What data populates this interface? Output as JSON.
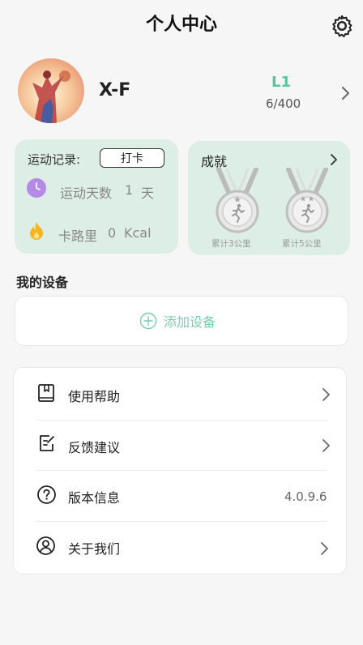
{
  "header": {
    "title": "个人中心",
    "settings_icon": "gear-icon"
  },
  "profile": {
    "username": "X-F",
    "level": "L1",
    "progress": "6/400"
  },
  "exercise": {
    "label": "运动记录:",
    "checkin_label": "打卡",
    "days_label": "运动天数",
    "days_value": "1",
    "days_unit": "天",
    "cal_label": "卡路里",
    "cal_value": "0",
    "cal_unit": "Kcal"
  },
  "achievements": {
    "title": "成就",
    "medals": [
      {
        "caption": "累计3公里",
        "stars": 1
      },
      {
        "caption": "累计5公里",
        "stars": 2
      }
    ]
  },
  "devices": {
    "section_title": "我的设备",
    "add_label": "添加设备"
  },
  "menu": {
    "items": [
      {
        "label": "使用帮助",
        "icon": "book-icon"
      },
      {
        "label": "反馈建议",
        "icon": "edit-note-icon"
      },
      {
        "label": "版本信息",
        "icon": "help-circle-icon",
        "value": "4.0.9.6"
      },
      {
        "label": "关于我们",
        "icon": "user-circle-icon"
      }
    ]
  },
  "colors": {
    "accent": "#52c7a2",
    "card_bg": "#ddeee6",
    "page_bg": "#f6f6f6"
  }
}
